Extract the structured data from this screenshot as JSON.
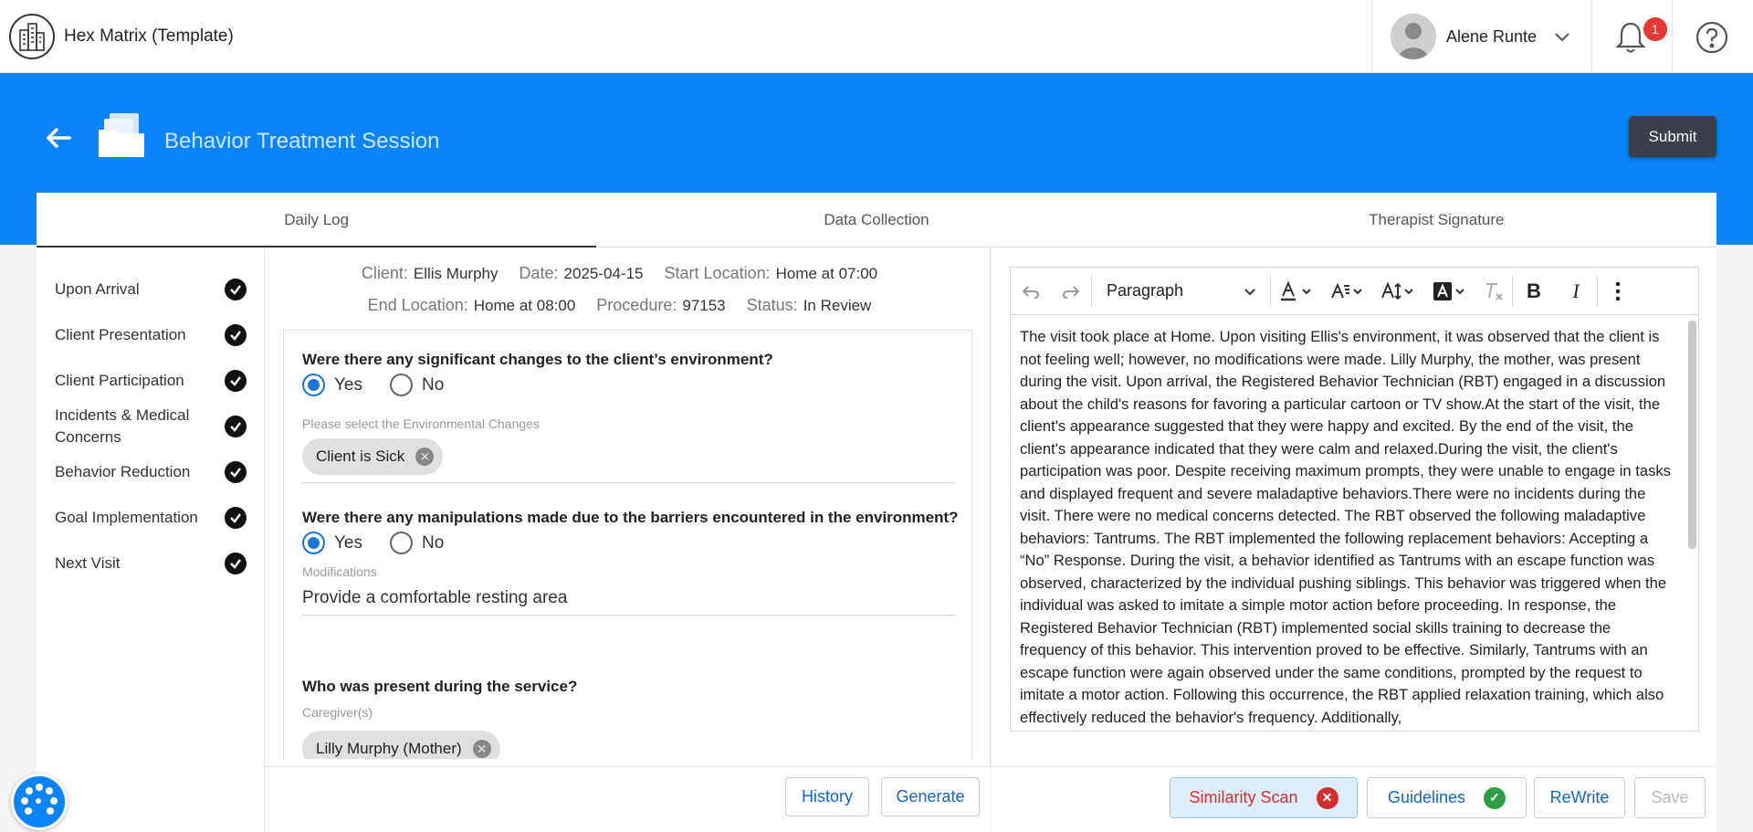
{
  "app": {
    "title": "Hex Matrix (Template)"
  },
  "user": {
    "name": "Alene Runte",
    "notification_count": "1"
  },
  "page": {
    "title": "Behavior Treatment Session",
    "submit_label": "Submit"
  },
  "tabs": [
    {
      "label": "Daily Log",
      "active": true
    },
    {
      "label": "Data Collection",
      "active": false
    },
    {
      "label": "Therapist Signature",
      "active": false
    }
  ],
  "sidebar": {
    "items": [
      {
        "label": "Upon Arrival",
        "done": true
      },
      {
        "label": "Client Presentation",
        "done": true
      },
      {
        "label": "Client Participation",
        "done": true
      },
      {
        "label": "Incidents & Medical Concerns",
        "done": true
      },
      {
        "label": "Behavior Reduction",
        "done": true
      },
      {
        "label": "Goal Implementation",
        "done": true
      },
      {
        "label": "Next Visit",
        "done": true
      }
    ]
  },
  "session": {
    "client_label": "Client:",
    "client": "Ellis Murphy",
    "date_label": "Date:",
    "date": "2025-04-15",
    "start_label": "Start Location:",
    "start": "Home at 07:00",
    "end_label": "End Location:",
    "end": "Home at 08:00",
    "procedure_label": "Procedure:",
    "procedure": "97153",
    "status_label": "Status:",
    "status": "In Review"
  },
  "form": {
    "q1": {
      "question": "Were there any significant changes to the client’s environment?",
      "yes": "Yes",
      "no": "No",
      "selected": "Yes",
      "select_label": "Please select the Environmental Changes",
      "chip": "Client is Sick"
    },
    "q2": {
      "question": "Were there any manipulations made due to the barriers encountered in the environment?",
      "yes": "Yes",
      "no": "No",
      "selected": "Yes",
      "field_label": "Modifications",
      "field_value": "Provide a comfortable resting area"
    },
    "q3": {
      "question": "Who was present during the service?",
      "field_label": "Caregiver(s)",
      "chip": "Lilly Murphy (Mother)"
    }
  },
  "center_footer": {
    "history": "History",
    "generate": "Generate"
  },
  "editor": {
    "block_format": "Paragraph",
    "text": "The visit took place at Home. Upon visiting Ellis's environment, it was observed that the client is not feeling well; however, no modifications were made. Lilly Murphy, the mother, was present during the visit. Upon arrival, the Registered Behavior Technician (RBT) engaged in a discussion about the child's reasons for favoring a particular cartoon or TV show.At the start of the visit, the client's appearance suggested that they were happy and excited. By the end of the visit, the client's appearance indicated that they were calm and relaxed.During the visit, the client's participation was poor. Despite receiving maximum prompts, they were unable to engage in tasks and displayed frequent and severe maladaptive behaviors.There were no incidents during the visit. There were no medical concerns detected. The RBT observed the following maladaptive behaviors: Tantrums. The RBT implemented the following replacement behaviors: Accepting a “No” Response. During the visit, a behavior identified as Tantrums with an escape function was observed, characterized by the individual pushing siblings. This behavior was triggered when the individual was asked to imitate a simple motor action before proceeding. In response, the Registered Behavior Technician (RBT) implemented social skills training to decrease the frequency of this behavior. This intervention proved to be effective. Similarly, Tantrums with an escape function were again observed under the same conditions, prompted by the request to imitate a motor action. Following this occurrence, the RBT applied relaxation training, which also effectively reduced the behavior's frequency. Additionally,"
  },
  "right_footer": {
    "similarity": "Similarity Scan",
    "guidelines": "Guidelines",
    "rewrite": "ReWrite",
    "save": "Save"
  },
  "colors": {
    "brand": "#0a84f7",
    "error": "#d32f2f",
    "success": "#2e9e44",
    "link": "#1565c0"
  }
}
